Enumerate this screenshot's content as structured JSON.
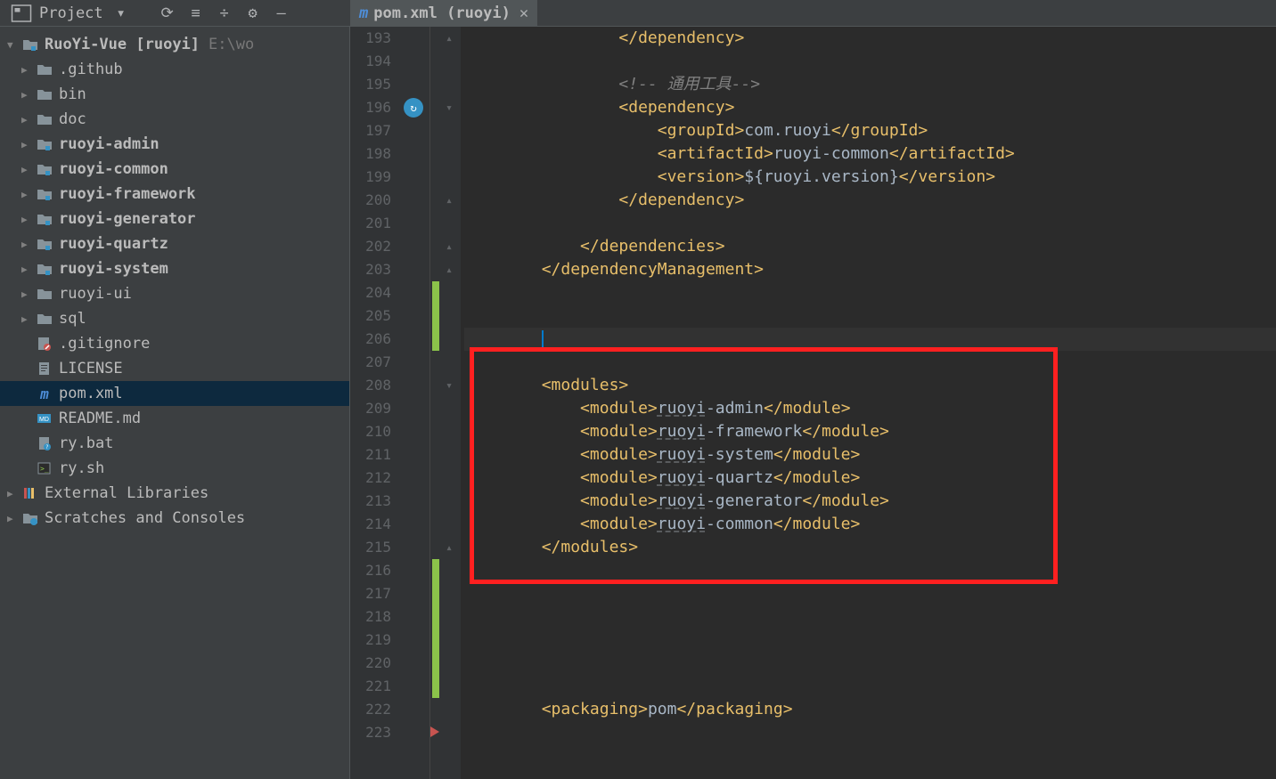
{
  "toolbar": {
    "project_label": "Project"
  },
  "tab": {
    "filename": "pom.xml",
    "suffix": "(ruoyi)"
  },
  "tree": {
    "root": {
      "label": "RuoYi-Vue",
      "bracket": "[ruoyi]",
      "path": "E:\\wo"
    },
    "items": [
      {
        "label": ".github",
        "type": "folder",
        "bold": false
      },
      {
        "label": "bin",
        "type": "folder",
        "bold": false
      },
      {
        "label": "doc",
        "type": "folder",
        "bold": false
      },
      {
        "label": "ruoyi-admin",
        "type": "module",
        "bold": true
      },
      {
        "label": "ruoyi-common",
        "type": "module",
        "bold": true
      },
      {
        "label": "ruoyi-framework",
        "type": "module",
        "bold": true
      },
      {
        "label": "ruoyi-generator",
        "type": "module",
        "bold": true
      },
      {
        "label": "ruoyi-quartz",
        "type": "module",
        "bold": true
      },
      {
        "label": "ruoyi-system",
        "type": "module",
        "bold": true
      },
      {
        "label": "ruoyi-ui",
        "type": "folder",
        "bold": false
      },
      {
        "label": "sql",
        "type": "folder",
        "bold": false
      },
      {
        "label": ".gitignore",
        "type": "gitignore",
        "bold": false
      },
      {
        "label": "LICENSE",
        "type": "file-text",
        "bold": false
      },
      {
        "label": "pom.xml",
        "type": "maven",
        "bold": false,
        "selected": true
      },
      {
        "label": "README.md",
        "type": "md",
        "bold": false
      },
      {
        "label": "ry.bat",
        "type": "bat",
        "bold": false
      },
      {
        "label": "ry.sh",
        "type": "sh",
        "bold": false
      }
    ],
    "external_libs": "External Libraries",
    "scratches": "Scratches and Consoles"
  },
  "editor": {
    "line_start": 193,
    "lines": [
      {
        "n": 193,
        "i": 4,
        "parts": [
          {
            "t": "</",
            "c": "bracket"
          },
          {
            "t": "dependency",
            "c": "tag"
          },
          {
            "t": ">",
            "c": "bracket"
          }
        ]
      },
      {
        "n": 194,
        "i": 0,
        "parts": []
      },
      {
        "n": 195,
        "i": 4,
        "parts": [
          {
            "t": "<!-- 通用工具-->",
            "c": "comment"
          }
        ]
      },
      {
        "n": 196,
        "i": 4,
        "parts": [
          {
            "t": "<",
            "c": "bracket"
          },
          {
            "t": "dependency",
            "c": "tag"
          },
          {
            "t": ">",
            "c": "bracket"
          }
        ]
      },
      {
        "n": 197,
        "i": 5,
        "parts": [
          {
            "t": "<",
            "c": "bracket"
          },
          {
            "t": "groupId",
            "c": "tag"
          },
          {
            "t": ">",
            "c": "bracket"
          },
          {
            "t": "com.ruoyi",
            "c": "text"
          },
          {
            "t": "</",
            "c": "bracket"
          },
          {
            "t": "groupId",
            "c": "tag"
          },
          {
            "t": ">",
            "c": "bracket"
          }
        ]
      },
      {
        "n": 198,
        "i": 5,
        "parts": [
          {
            "t": "<",
            "c": "bracket"
          },
          {
            "t": "artifactId",
            "c": "tag"
          },
          {
            "t": ">",
            "c": "bracket"
          },
          {
            "t": "ruoyi-common",
            "c": "text"
          },
          {
            "t": "</",
            "c": "bracket"
          },
          {
            "t": "artifactId",
            "c": "tag"
          },
          {
            "t": ">",
            "c": "bracket"
          }
        ]
      },
      {
        "n": 199,
        "i": 5,
        "parts": [
          {
            "t": "<",
            "c": "bracket"
          },
          {
            "t": "version",
            "c": "tag"
          },
          {
            "t": ">",
            "c": "bracket"
          },
          {
            "t": "${ruoyi.version}",
            "c": "text"
          },
          {
            "t": "</",
            "c": "bracket"
          },
          {
            "t": "version",
            "c": "tag"
          },
          {
            "t": ">",
            "c": "bracket"
          }
        ]
      },
      {
        "n": 200,
        "i": 4,
        "parts": [
          {
            "t": "</",
            "c": "bracket"
          },
          {
            "t": "dependency",
            "c": "tag"
          },
          {
            "t": ">",
            "c": "bracket"
          }
        ]
      },
      {
        "n": 201,
        "i": 0,
        "parts": []
      },
      {
        "n": 202,
        "i": 3,
        "parts": [
          {
            "t": "</",
            "c": "bracket"
          },
          {
            "t": "dependencies",
            "c": "tag"
          },
          {
            "t": ">",
            "c": "bracket"
          }
        ]
      },
      {
        "n": 203,
        "i": 2,
        "parts": [
          {
            "t": "</",
            "c": "bracket"
          },
          {
            "t": "dependencyManagement",
            "c": "tag"
          },
          {
            "t": ">",
            "c": "bracket"
          }
        ]
      },
      {
        "n": 204,
        "i": 0,
        "parts": []
      },
      {
        "n": 205,
        "i": 0,
        "parts": []
      },
      {
        "n": 206,
        "i": 2,
        "parts": [],
        "caret": true
      },
      {
        "n": 207,
        "i": 0,
        "parts": []
      },
      {
        "n": 208,
        "i": 2,
        "parts": [
          {
            "t": "<",
            "c": "bracket"
          },
          {
            "t": "modules",
            "c": "tag"
          },
          {
            "t": ">",
            "c": "bracket"
          }
        ]
      },
      {
        "n": 209,
        "i": 3,
        "parts": [
          {
            "t": "<",
            "c": "bracket"
          },
          {
            "t": "module",
            "c": "tag"
          },
          {
            "t": ">",
            "c": "bracket"
          },
          {
            "t": "ruoyi",
            "c": "text underline"
          },
          {
            "t": "-admin",
            "c": "text"
          },
          {
            "t": "</",
            "c": "bracket"
          },
          {
            "t": "module",
            "c": "tag"
          },
          {
            "t": ">",
            "c": "bracket"
          }
        ]
      },
      {
        "n": 210,
        "i": 3,
        "parts": [
          {
            "t": "<",
            "c": "bracket"
          },
          {
            "t": "module",
            "c": "tag"
          },
          {
            "t": ">",
            "c": "bracket"
          },
          {
            "t": "ruoyi",
            "c": "text underline"
          },
          {
            "t": "-framework",
            "c": "text"
          },
          {
            "t": "</",
            "c": "bracket"
          },
          {
            "t": "module",
            "c": "tag"
          },
          {
            "t": ">",
            "c": "bracket"
          }
        ]
      },
      {
        "n": 211,
        "i": 3,
        "parts": [
          {
            "t": "<",
            "c": "bracket"
          },
          {
            "t": "module",
            "c": "tag"
          },
          {
            "t": ">",
            "c": "bracket"
          },
          {
            "t": "ruoyi",
            "c": "text underline"
          },
          {
            "t": "-system",
            "c": "text"
          },
          {
            "t": "</",
            "c": "bracket"
          },
          {
            "t": "module",
            "c": "tag"
          },
          {
            "t": ">",
            "c": "bracket"
          }
        ]
      },
      {
        "n": 212,
        "i": 3,
        "parts": [
          {
            "t": "<",
            "c": "bracket"
          },
          {
            "t": "module",
            "c": "tag"
          },
          {
            "t": ">",
            "c": "bracket"
          },
          {
            "t": "ruoyi",
            "c": "text underline"
          },
          {
            "t": "-quartz",
            "c": "text"
          },
          {
            "t": "</",
            "c": "bracket"
          },
          {
            "t": "module",
            "c": "tag"
          },
          {
            "t": ">",
            "c": "bracket"
          }
        ]
      },
      {
        "n": 213,
        "i": 3,
        "parts": [
          {
            "t": "<",
            "c": "bracket"
          },
          {
            "t": "module",
            "c": "tag"
          },
          {
            "t": ">",
            "c": "bracket"
          },
          {
            "t": "ruoyi",
            "c": "text underline"
          },
          {
            "t": "-generator",
            "c": "text"
          },
          {
            "t": "</",
            "c": "bracket"
          },
          {
            "t": "module",
            "c": "tag"
          },
          {
            "t": ">",
            "c": "bracket"
          }
        ]
      },
      {
        "n": 214,
        "i": 3,
        "parts": [
          {
            "t": "<",
            "c": "bracket"
          },
          {
            "t": "module",
            "c": "tag"
          },
          {
            "t": ">",
            "c": "bracket"
          },
          {
            "t": "ruoyi",
            "c": "text underline"
          },
          {
            "t": "-common",
            "c": "text"
          },
          {
            "t": "</",
            "c": "bracket"
          },
          {
            "t": "module",
            "c": "tag"
          },
          {
            "t": ">",
            "c": "bracket"
          }
        ]
      },
      {
        "n": 215,
        "i": 2,
        "parts": [
          {
            "t": "</",
            "c": "bracket"
          },
          {
            "t": "modules",
            "c": "tag"
          },
          {
            "t": ">",
            "c": "bracket"
          }
        ]
      },
      {
        "n": 216,
        "i": 0,
        "parts": []
      },
      {
        "n": 217,
        "i": 0,
        "parts": []
      },
      {
        "n": 218,
        "i": 0,
        "parts": []
      },
      {
        "n": 219,
        "i": 0,
        "parts": []
      },
      {
        "n": 220,
        "i": 0,
        "parts": []
      },
      {
        "n": 221,
        "i": 0,
        "parts": []
      },
      {
        "n": 222,
        "i": 2,
        "parts": [
          {
            "t": "<",
            "c": "bracket"
          },
          {
            "t": "packaging",
            "c": "tag"
          },
          {
            "t": ">",
            "c": "bracket"
          },
          {
            "t": "pom",
            "c": "text"
          },
          {
            "t": "</",
            "c": "bracket"
          },
          {
            "t": "packaging",
            "c": "tag"
          },
          {
            "t": ">",
            "c": "bracket"
          }
        ]
      },
      {
        "n": 223,
        "i": 0,
        "parts": []
      }
    ],
    "change_segments": [
      {
        "start": 204,
        "end": 206
      },
      {
        "start": 216,
        "end": 221
      }
    ],
    "change_tri": [
      223
    ],
    "fold_markers": [
      {
        "line": 193,
        "dir": "up"
      },
      {
        "line": 196,
        "dir": "down"
      },
      {
        "line": 200,
        "dir": "up"
      },
      {
        "line": 202,
        "dir": "up"
      },
      {
        "line": 203,
        "dir": "up"
      },
      {
        "line": 208,
        "dir": "down"
      },
      {
        "line": 215,
        "dir": "up"
      }
    ],
    "gutter_icons": [
      {
        "line": 196,
        "name": "maven-update-icon"
      }
    ],
    "highlight": {
      "startLine": 207,
      "endLine": 216
    }
  }
}
